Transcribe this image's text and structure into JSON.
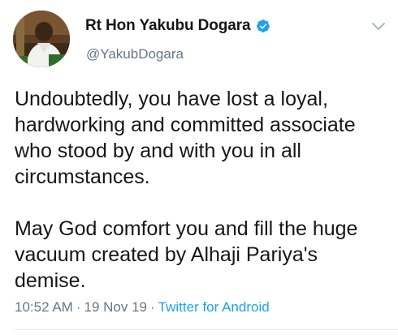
{
  "author": {
    "display_name": "Rt Hon Yakubu Dogara",
    "handle": "@YakubDogara",
    "verified": true
  },
  "tweet": {
    "paragraphs": [
      "Undoubtedly, you have lost a loyal, hardworking and committed associate who stood by and with you in all circumstances.",
      "May God comfort you and fill the huge vacuum created by Alhaji Pariya's demise."
    ]
  },
  "meta": {
    "time": "10:52 AM",
    "date": "19 Nov 19",
    "separator": "·",
    "source": "Twitter for Android"
  },
  "colors": {
    "accent": "#1da1f2",
    "secondary_text": "#657786",
    "primary_text": "#14171a"
  },
  "icons": {
    "verified": "verified-badge-icon",
    "menu": "chevron-down-icon"
  }
}
